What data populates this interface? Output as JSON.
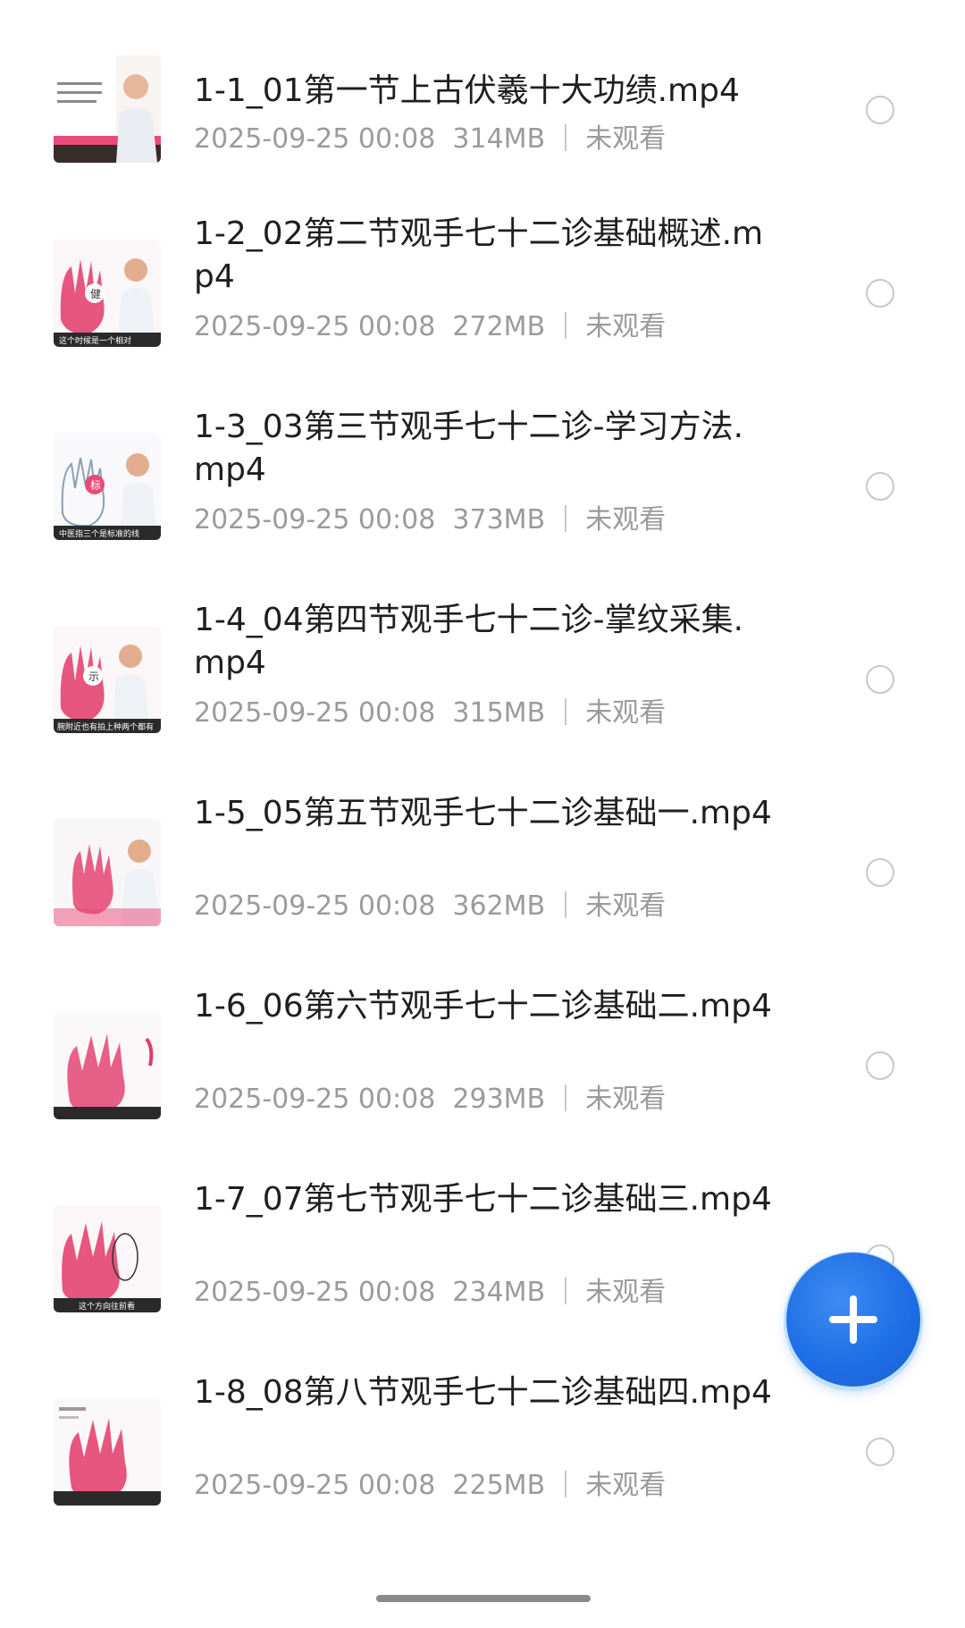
{
  "videos": [
    {
      "title": "1-1_01第一节上古伏羲十大功绩.mp4",
      "date": "2025-09-25 00:08",
      "size": "314MB",
      "status": "未观看"
    },
    {
      "title": "1-2_02第二节观手七十二诊基础概述.mp4",
      "date": "2025-09-25 00:08",
      "size": "272MB",
      "status": "未观看"
    },
    {
      "title": "1-3_03第三节观手七十二诊-学习方法.mp4",
      "date": "2025-09-25 00:08",
      "size": "373MB",
      "status": "未观看"
    },
    {
      "title": "1-4_04第四节观手七十二诊-掌纹采集.mp4",
      "date": "2025-09-25 00:08",
      "size": "315MB",
      "status": "未观看"
    },
    {
      "title": "1-5_05第五节观手七十二诊基础一.mp4",
      "date": "2025-09-25 00:08",
      "size": "362MB",
      "status": "未观看"
    },
    {
      "title": "1-6_06第六节观手七十二诊基础二.mp4",
      "date": "2025-09-25 00:08",
      "size": "293MB",
      "status": "未观看"
    },
    {
      "title": "1-7_07第七节观手七十二诊基础三.mp4",
      "date": "2025-09-25 00:08",
      "size": "234MB",
      "status": "未观看"
    },
    {
      "title": "1-8_08第八节观手七十二诊基础四.mp4",
      "date": "2025-09-25 00:08",
      "size": "225MB",
      "status": "未观看"
    }
  ],
  "thumb_captions": [
    "",
    "这个时候是一个相对",
    "中医指三个是标准的线",
    "腕附近也有拍上种两个都有",
    "",
    "",
    "这个方向往前看",
    ""
  ],
  "fab": {
    "icon": "plus-icon"
  },
  "colors": {
    "accent": "#1f6fe6",
    "title_text": "#1f1f1f",
    "meta_text": "#9b9b9b",
    "radio_border": "#c8c8c8"
  }
}
